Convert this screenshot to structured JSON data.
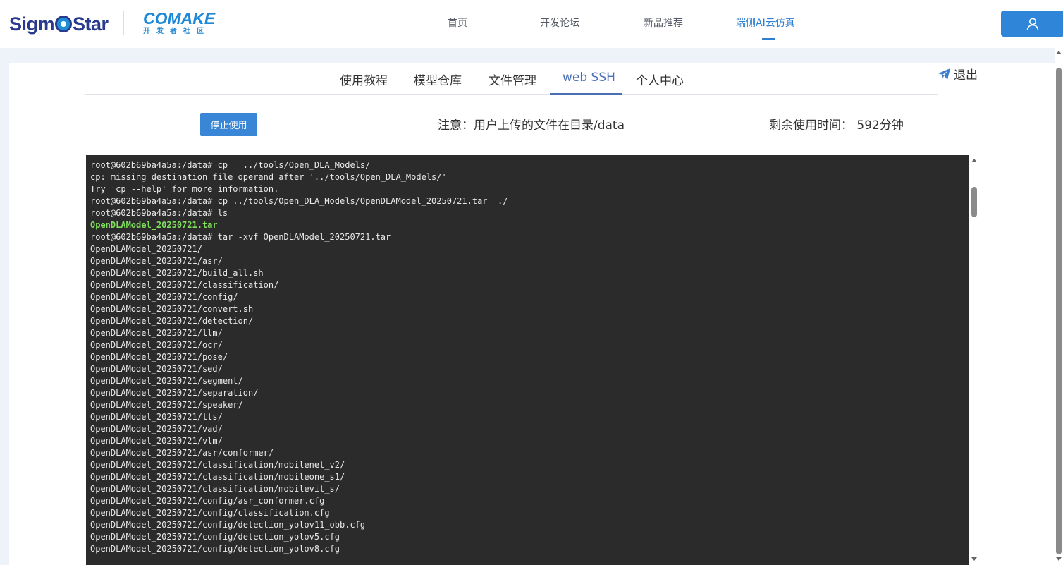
{
  "header": {
    "logo_sigmo_left": "Sigm",
    "logo_sigmo_right": "Star",
    "logo_comake_big": "COMAKE",
    "logo_comake_small": "开发者社区",
    "nav": [
      {
        "label": "首页"
      },
      {
        "label": "开发论坛"
      },
      {
        "label": "新品推荐"
      },
      {
        "label": "端侧AI云仿真"
      }
    ],
    "active_nav": "端侧AI云仿真",
    "user_icon": "user-icon"
  },
  "sub_tabs": [
    {
      "label": "使用教程"
    },
    {
      "label": "模型仓库"
    },
    {
      "label": "文件管理"
    },
    {
      "label": "web SSH"
    },
    {
      "label": "个人中心"
    }
  ],
  "active_sub_tab": "web SSH",
  "logout": {
    "label": "退出",
    "icon": "paper-plane-icon"
  },
  "controls": {
    "stop_button": "停止使用",
    "notice": "注意：用户上传的文件在目录/data",
    "remaining": "剩余使用时间： 592分钟"
  },
  "colors": {
    "accent": "#2f86d8",
    "terminal_bg": "#2b2b2b",
    "terminal_text": "#e8e8e8",
    "terminal_dir": "#7fe05a"
  },
  "terminal": {
    "lines": [
      {
        "text": "root@602b69ba4a5a:/data# cp   ../tools/Open_DLA_Models/",
        "style": ""
      },
      {
        "text": "cp: missing destination file operand after '../tools/Open_DLA_Models/'",
        "style": ""
      },
      {
        "text": "Try 'cp --help' for more information.",
        "style": ""
      },
      {
        "text": "root@602b69ba4a5a:/data# cp ../tools/Open_DLA_Models/OpenDLAModel_20250721.tar  ./",
        "style": ""
      },
      {
        "text": "root@602b69ba4a5a:/data# ls",
        "style": ""
      },
      {
        "text": "OpenDLAModel_20250721.tar",
        "style": "dir-green"
      },
      {
        "text": "root@602b69ba4a5a:/data# tar -xvf OpenDLAModel_20250721.tar",
        "style": ""
      },
      {
        "text": "OpenDLAModel_20250721/",
        "style": ""
      },
      {
        "text": "OpenDLAModel_20250721/asr/",
        "style": ""
      },
      {
        "text": "OpenDLAModel_20250721/build_all.sh",
        "style": ""
      },
      {
        "text": "OpenDLAModel_20250721/classification/",
        "style": ""
      },
      {
        "text": "OpenDLAModel_20250721/config/",
        "style": ""
      },
      {
        "text": "OpenDLAModel_20250721/convert.sh",
        "style": ""
      },
      {
        "text": "OpenDLAModel_20250721/detection/",
        "style": ""
      },
      {
        "text": "OpenDLAModel_20250721/llm/",
        "style": ""
      },
      {
        "text": "OpenDLAModel_20250721/ocr/",
        "style": ""
      },
      {
        "text": "OpenDLAModel_20250721/pose/",
        "style": ""
      },
      {
        "text": "OpenDLAModel_20250721/sed/",
        "style": ""
      },
      {
        "text": "OpenDLAModel_20250721/segment/",
        "style": ""
      },
      {
        "text": "OpenDLAModel_20250721/separation/",
        "style": ""
      },
      {
        "text": "OpenDLAModel_20250721/speaker/",
        "style": ""
      },
      {
        "text": "OpenDLAModel_20250721/tts/",
        "style": ""
      },
      {
        "text": "OpenDLAModel_20250721/vad/",
        "style": ""
      },
      {
        "text": "OpenDLAModel_20250721/vlm/",
        "style": ""
      },
      {
        "text": "OpenDLAModel_20250721/asr/conformer/",
        "style": ""
      },
      {
        "text": "OpenDLAModel_20250721/classification/mobilenet_v2/",
        "style": ""
      },
      {
        "text": "OpenDLAModel_20250721/classification/mobileone_s1/",
        "style": ""
      },
      {
        "text": "OpenDLAModel_20250721/classification/mobilevit_s/",
        "style": ""
      },
      {
        "text": "OpenDLAModel_20250721/config/asr_conformer.cfg",
        "style": ""
      },
      {
        "text": "OpenDLAModel_20250721/config/classification.cfg",
        "style": ""
      },
      {
        "text": "OpenDLAModel_20250721/config/detection_yolov11_obb.cfg",
        "style": ""
      },
      {
        "text": "OpenDLAModel_20250721/config/detection_yolov5.cfg",
        "style": ""
      },
      {
        "text": "OpenDLAModel_20250721/config/detection_yolov8.cfg",
        "style": ""
      }
    ]
  }
}
